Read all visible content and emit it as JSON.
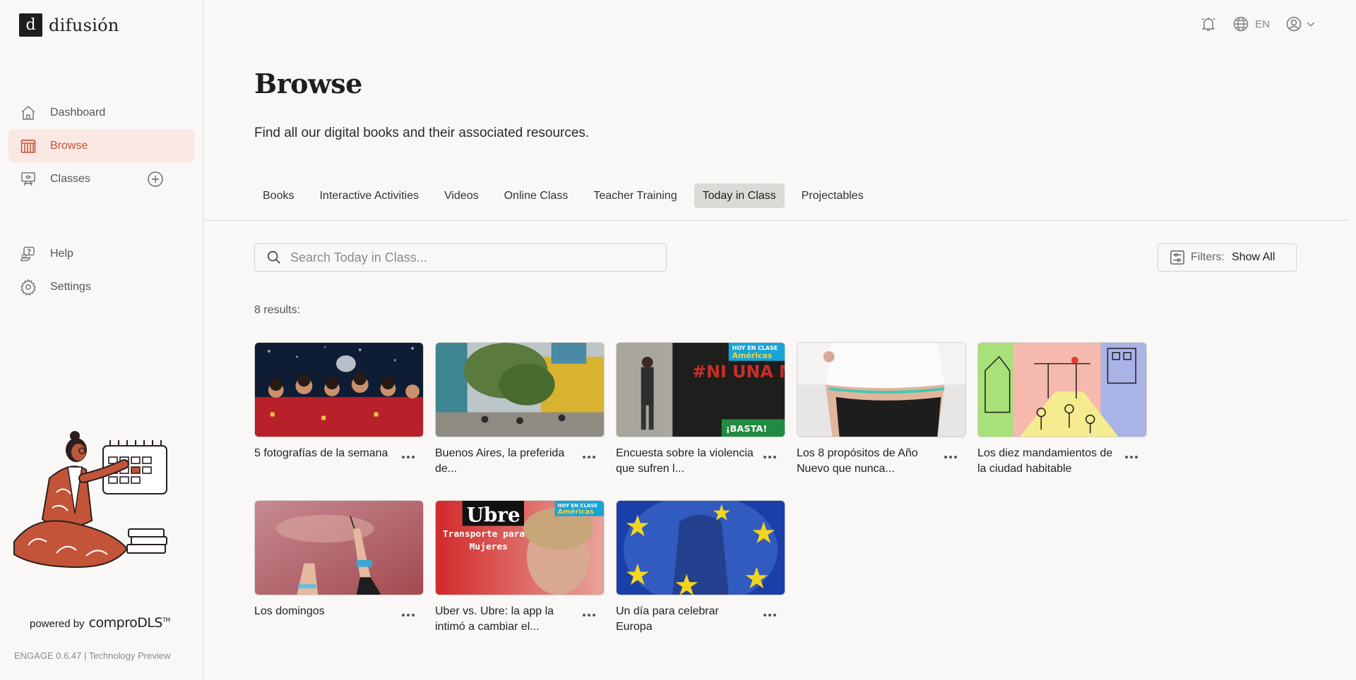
{
  "app": {
    "logo_mark": "d",
    "logo_text": "difusión",
    "powered_prefix": "powered by",
    "powered_brand": "comproDLS",
    "powered_tm": "TM",
    "version": "ENGAGE 0.6.47 | Technology Preview"
  },
  "sidebar": {
    "items": [
      {
        "label": "Dashboard",
        "icon": "home-icon"
      },
      {
        "label": "Browse",
        "icon": "library-icon",
        "active": true
      },
      {
        "label": "Classes",
        "icon": "classroom-icon"
      },
      {
        "label": "Help",
        "icon": "help-icon"
      },
      {
        "label": "Settings",
        "icon": "gear-icon"
      }
    ]
  },
  "header": {
    "language": "EN"
  },
  "page": {
    "title": "Browse",
    "subtitle": "Find all our digital books and their associated resources."
  },
  "tabs": [
    {
      "label": "Books"
    },
    {
      "label": "Interactive Activities"
    },
    {
      "label": "Videos"
    },
    {
      "label": "Online Class"
    },
    {
      "label": "Teacher Training"
    },
    {
      "label": "Today in Class",
      "active": true
    },
    {
      "label": "Projectables"
    }
  ],
  "search": {
    "placeholder": "Search Today in Class...",
    "value": ""
  },
  "filters": {
    "label": "Filters:",
    "value": "Show All"
  },
  "results": {
    "count_text": "8 results:",
    "items": [
      {
        "title": "5 fotografías de la semana"
      },
      {
        "title": "Buenos Aires, la preferida de..."
      },
      {
        "title": "Encuesta sobre la violencia que sufren l..."
      },
      {
        "title": "Los 8 propósitos de Año Nuevo que nunca..."
      },
      {
        "title": "Los diez mandamientos de la ciudad habitable"
      },
      {
        "title": "Los domingos"
      },
      {
        "title": "Uber vs. Ubre: la app la intimó a cambiar el..."
      },
      {
        "title": "Un día para celebrar Europa"
      }
    ]
  },
  "thumb_text": {
    "badge_top": "HOY EN CLASE",
    "badge_bottom": "Américas",
    "ni_una": "#NI UNA MENOS",
    "basta": "¡BASTA!",
    "ubre_title": "Ubre",
    "ubre_sub1": "Transporte para",
    "ubre_sub2": "Mujeres"
  },
  "colors": {
    "accent": "#c45438",
    "active_nav_bg": "#fbe8e3",
    "active_tab_bg": "#dcdad7"
  }
}
